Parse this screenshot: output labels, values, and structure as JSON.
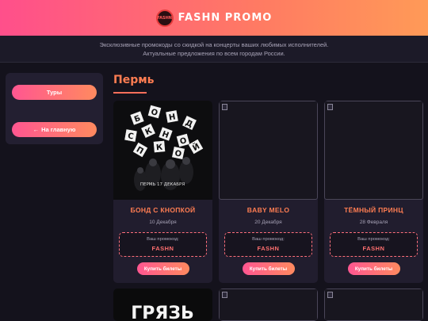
{
  "header": {
    "brand": "FASHN PROMO",
    "logo_text": "FASHN"
  },
  "subbar": {
    "line1": "Эксклюзивные промокоды со скидкой на концерты ваших любимых исполнителей.",
    "line2": "Актуальные предложения по всем городам России."
  },
  "sidebar": {
    "tours_label": "Туры",
    "home_label": "На главную",
    "home_arrow": "←"
  },
  "main": {
    "city": "Пермь"
  },
  "promo_label": "Ваш промокод:",
  "buy_label": "Купить билеты",
  "cards": [
    {
      "name": "БОНД С КНОПКОЙ",
      "date": "10 Декабря",
      "code": "FASHN",
      "poster_letters": [
        "Б",
        "О",
        "Н",
        "Д",
        "С",
        "К",
        "Н",
        "О",
        "П",
        "К",
        "О",
        "Й"
      ],
      "poster_caption": "ПЕРМЬ 17 ДЕКАБРЯ"
    },
    {
      "name": "BABY MELO",
      "date": "20 Декабря",
      "code": "FASHN"
    },
    {
      "name": "ТЁМНЫЙ ПРИНЦ",
      "date": "28 Февраля",
      "code": "FASHN"
    }
  ],
  "row2": {
    "poster_word": "ГРЯЗЬ"
  }
}
